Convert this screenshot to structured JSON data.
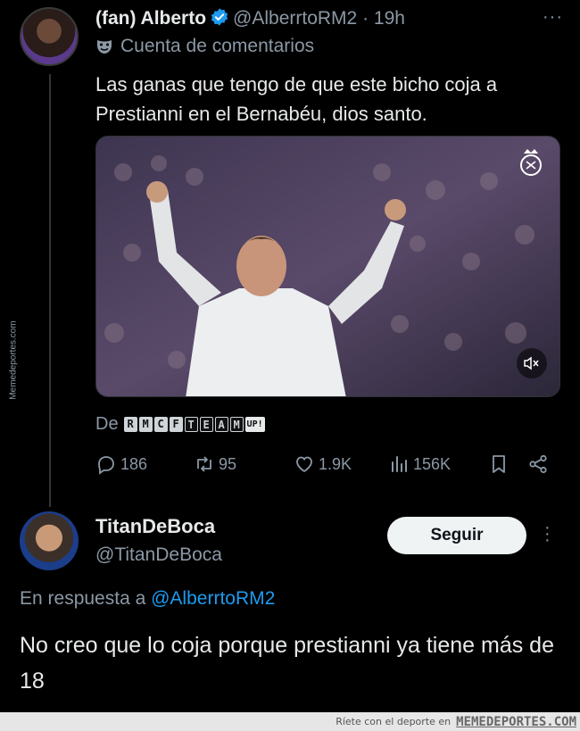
{
  "tweet": {
    "author_name": "(fan) Alberto",
    "author_handle": "@AlberrtoRM2",
    "time": "19h",
    "commentary_label": "Cuenta de comentarios",
    "text": "Las ganas que tengo de que este bicho coja a Prestianni en el Bernabéu, dios santo.",
    "source_prefix": "De",
    "source_tiles": [
      "R",
      "M",
      "C",
      "F",
      "T",
      "E",
      "A",
      "M",
      "UP!"
    ],
    "stats": {
      "replies": "186",
      "retweets": "95",
      "likes": "1.9K",
      "views": "156K"
    }
  },
  "reply": {
    "author_name": "TitanDeBoca",
    "author_handle": "@TitanDeBoca",
    "follow_label": "Seguir",
    "reply_prefix": "En respuesta a",
    "reply_mention": "@AlberrtoRM2",
    "text": "No creo que lo coja porque prestianni ya tiene más de 18"
  },
  "watermark": {
    "side": "Memedeportes.com",
    "footer_tagline": "Ríete con el deporte en",
    "footer_brand": "MEMEDEPORTES.COM"
  },
  "colors": {
    "background": "#000000",
    "text": "#e7e9ea",
    "muted": "#8b98a5",
    "link": "#1d9bf0",
    "verified": "#1d9bf0"
  }
}
